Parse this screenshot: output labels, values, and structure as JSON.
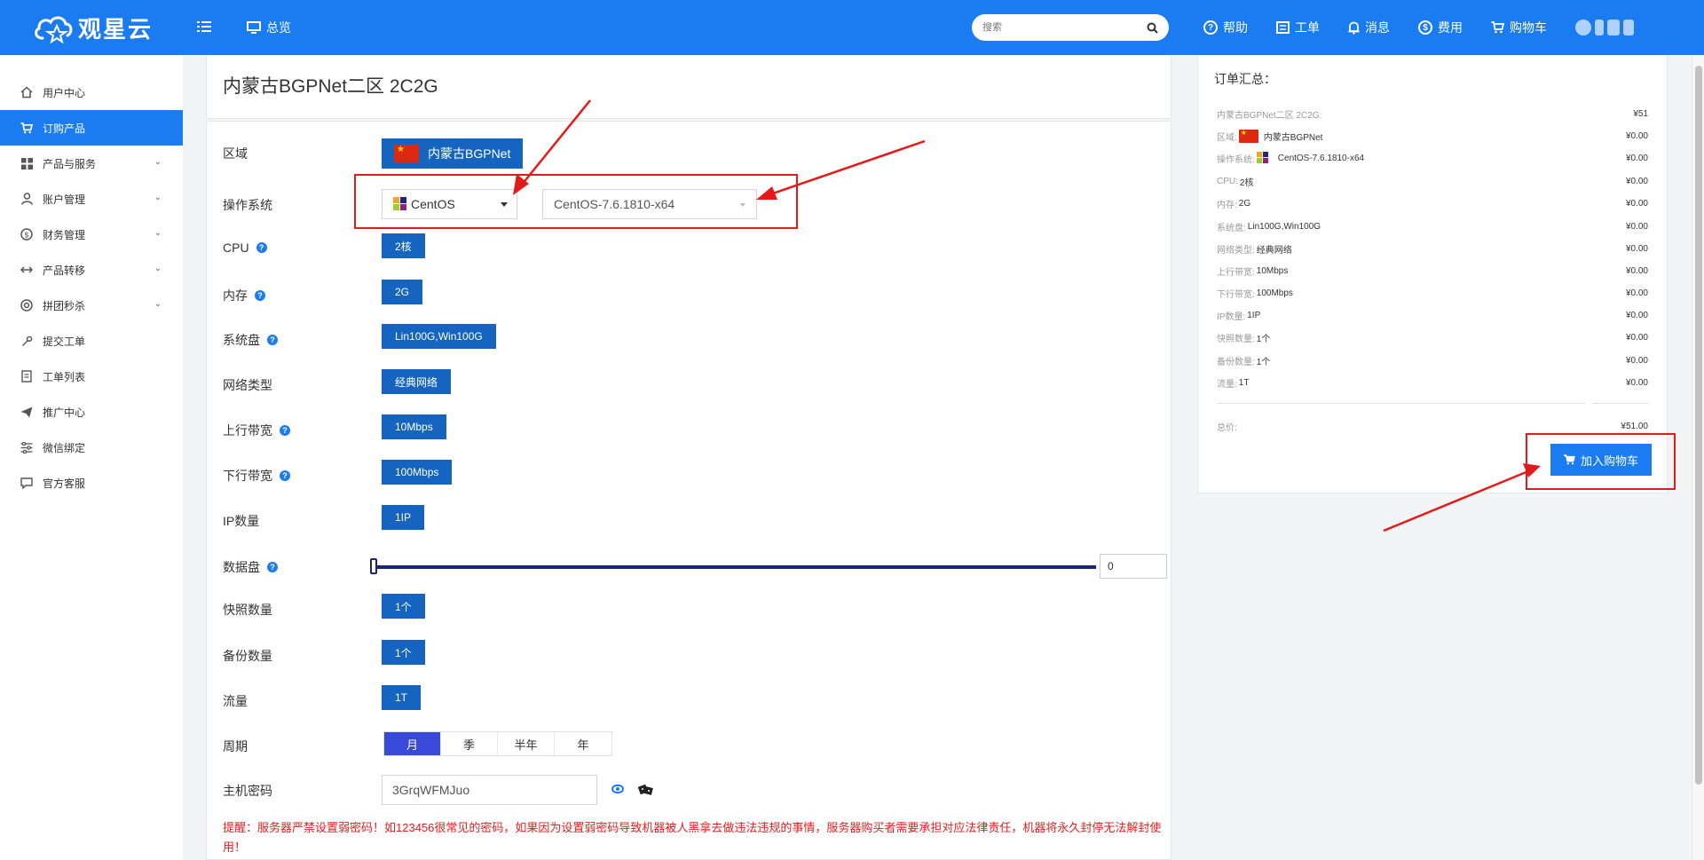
{
  "brand": {
    "name": "观星云",
    "color": "#1b7cf2"
  },
  "topbar": {
    "overview_label": "总览",
    "search_placeholder": "搜索",
    "items": [
      {
        "icon": "help-icon",
        "label": "帮助"
      },
      {
        "icon": "ticket-icon",
        "label": "工单"
      },
      {
        "icon": "bell-icon",
        "label": "消息"
      },
      {
        "icon": "fee-icon",
        "label": "费用"
      },
      {
        "icon": "cart-icon",
        "label": "购物车"
      }
    ]
  },
  "sidebar": {
    "items": [
      {
        "icon": "home-icon",
        "label": "用户中心",
        "active": false,
        "expandable": false
      },
      {
        "icon": "cart-icon",
        "label": "订购产品",
        "active": true,
        "expandable": false
      },
      {
        "icon": "grid-icon",
        "label": "产品与服务",
        "active": false,
        "expandable": true
      },
      {
        "icon": "user-icon",
        "label": "账户管理",
        "active": false,
        "expandable": true
      },
      {
        "icon": "finance-icon",
        "label": "财务管理",
        "active": false,
        "expandable": true
      },
      {
        "icon": "transfer-icon",
        "label": "产品转移",
        "active": false,
        "expandable": true
      },
      {
        "icon": "group-buy-icon",
        "label": "拼团秒杀",
        "active": false,
        "expandable": true
      },
      {
        "icon": "wrench-icon",
        "label": "提交工单",
        "active": false,
        "expandable": false
      },
      {
        "icon": "list-icon",
        "label": "工单列表",
        "active": false,
        "expandable": false
      },
      {
        "icon": "send-icon",
        "label": "推广中心",
        "active": false,
        "expandable": false
      },
      {
        "icon": "sliders-icon",
        "label": "微信绑定",
        "active": false,
        "expandable": false
      },
      {
        "icon": "chat-icon",
        "label": "官方客服",
        "active": false,
        "expandable": false
      }
    ]
  },
  "product": {
    "title": "内蒙古BGPNet二区 2C2G"
  },
  "config": {
    "region": {
      "label": "区域",
      "value": "内蒙古BGPNet"
    },
    "os": {
      "label": "操作系统",
      "family": "CentOS",
      "version": "CentOS-7.6.1810-x64"
    },
    "cpu": {
      "label": "CPU",
      "value": "2核"
    },
    "memory": {
      "label": "内存",
      "value": "2G"
    },
    "system_disk": {
      "label": "系统盘",
      "value": "Lin100G,Win100G"
    },
    "network": {
      "label": "网络类型",
      "value": "经典网络"
    },
    "upload": {
      "label": "上行带宽",
      "value": "10Mbps"
    },
    "download": {
      "label": "下行带宽",
      "value": "100Mbps"
    },
    "ip_count": {
      "label": "IP数量",
      "value": "1IP"
    },
    "data_disk": {
      "label": "数据盘",
      "value": "0"
    },
    "snapshots": {
      "label": "快照数量",
      "value": "1个"
    },
    "backups": {
      "label": "备份数量",
      "value": "1个"
    },
    "traffic": {
      "label": "流量",
      "value": "1T"
    },
    "period": {
      "label": "周期",
      "options": [
        "月",
        "季",
        "半年",
        "年"
      ],
      "selected": "月"
    },
    "password": {
      "label": "主机密码",
      "value": "3GrqWFMJuo"
    },
    "warning": "提醒：服务器严禁设置弱密码！如123456很常见的密码，如果因为设置弱密码导致机器被人黑拿去做违法违规的事情，服务器购买者需要承担对应法律责任，机器将永久封停无法解封使用！"
  },
  "summary": {
    "title": "订单汇总：",
    "lines": [
      {
        "label": "内蒙古BGPNet二区 2C2G:",
        "value": "",
        "price": "¥51"
      },
      {
        "label": "区域:",
        "value": "内蒙古BGPNet",
        "price": "¥0.00"
      },
      {
        "label": "操作系统:",
        "value": "CentOS-7.6.1810-x64",
        "price": "¥0.00"
      },
      {
        "label": "CPU:",
        "value": "2核",
        "price": "¥0.00"
      },
      {
        "label": "内存:",
        "value": "2G",
        "price": "¥0.00"
      },
      {
        "label": "系统盘:",
        "value": "Lin100G,Win100G",
        "price": "¥0.00"
      },
      {
        "label": "网络类型:",
        "value": "经典网络",
        "price": "¥0.00"
      },
      {
        "label": "上行带宽:",
        "value": "10Mbps",
        "price": "¥0.00"
      },
      {
        "label": "下行带宽:",
        "value": "100Mbps",
        "price": "¥0.00"
      },
      {
        "label": "IP数量:",
        "value": "1IP",
        "price": "¥0.00"
      },
      {
        "label": "快照数量:",
        "value": "1个",
        "price": "¥0.00"
      },
      {
        "label": "备份数量:",
        "value": "1个",
        "price": "¥0.00"
      },
      {
        "label": "流量:",
        "value": "1T",
        "price": "¥0.00"
      }
    ],
    "total_label": "总价:",
    "total": "¥51.00",
    "add_to_cart": "加入购物车"
  },
  "colors": {
    "primary": "#1b7cf2",
    "option_blue": "#1565c0",
    "period_active": "#3949d9",
    "warning_red": "#e02020",
    "annotation_red": "#e31a1a"
  }
}
